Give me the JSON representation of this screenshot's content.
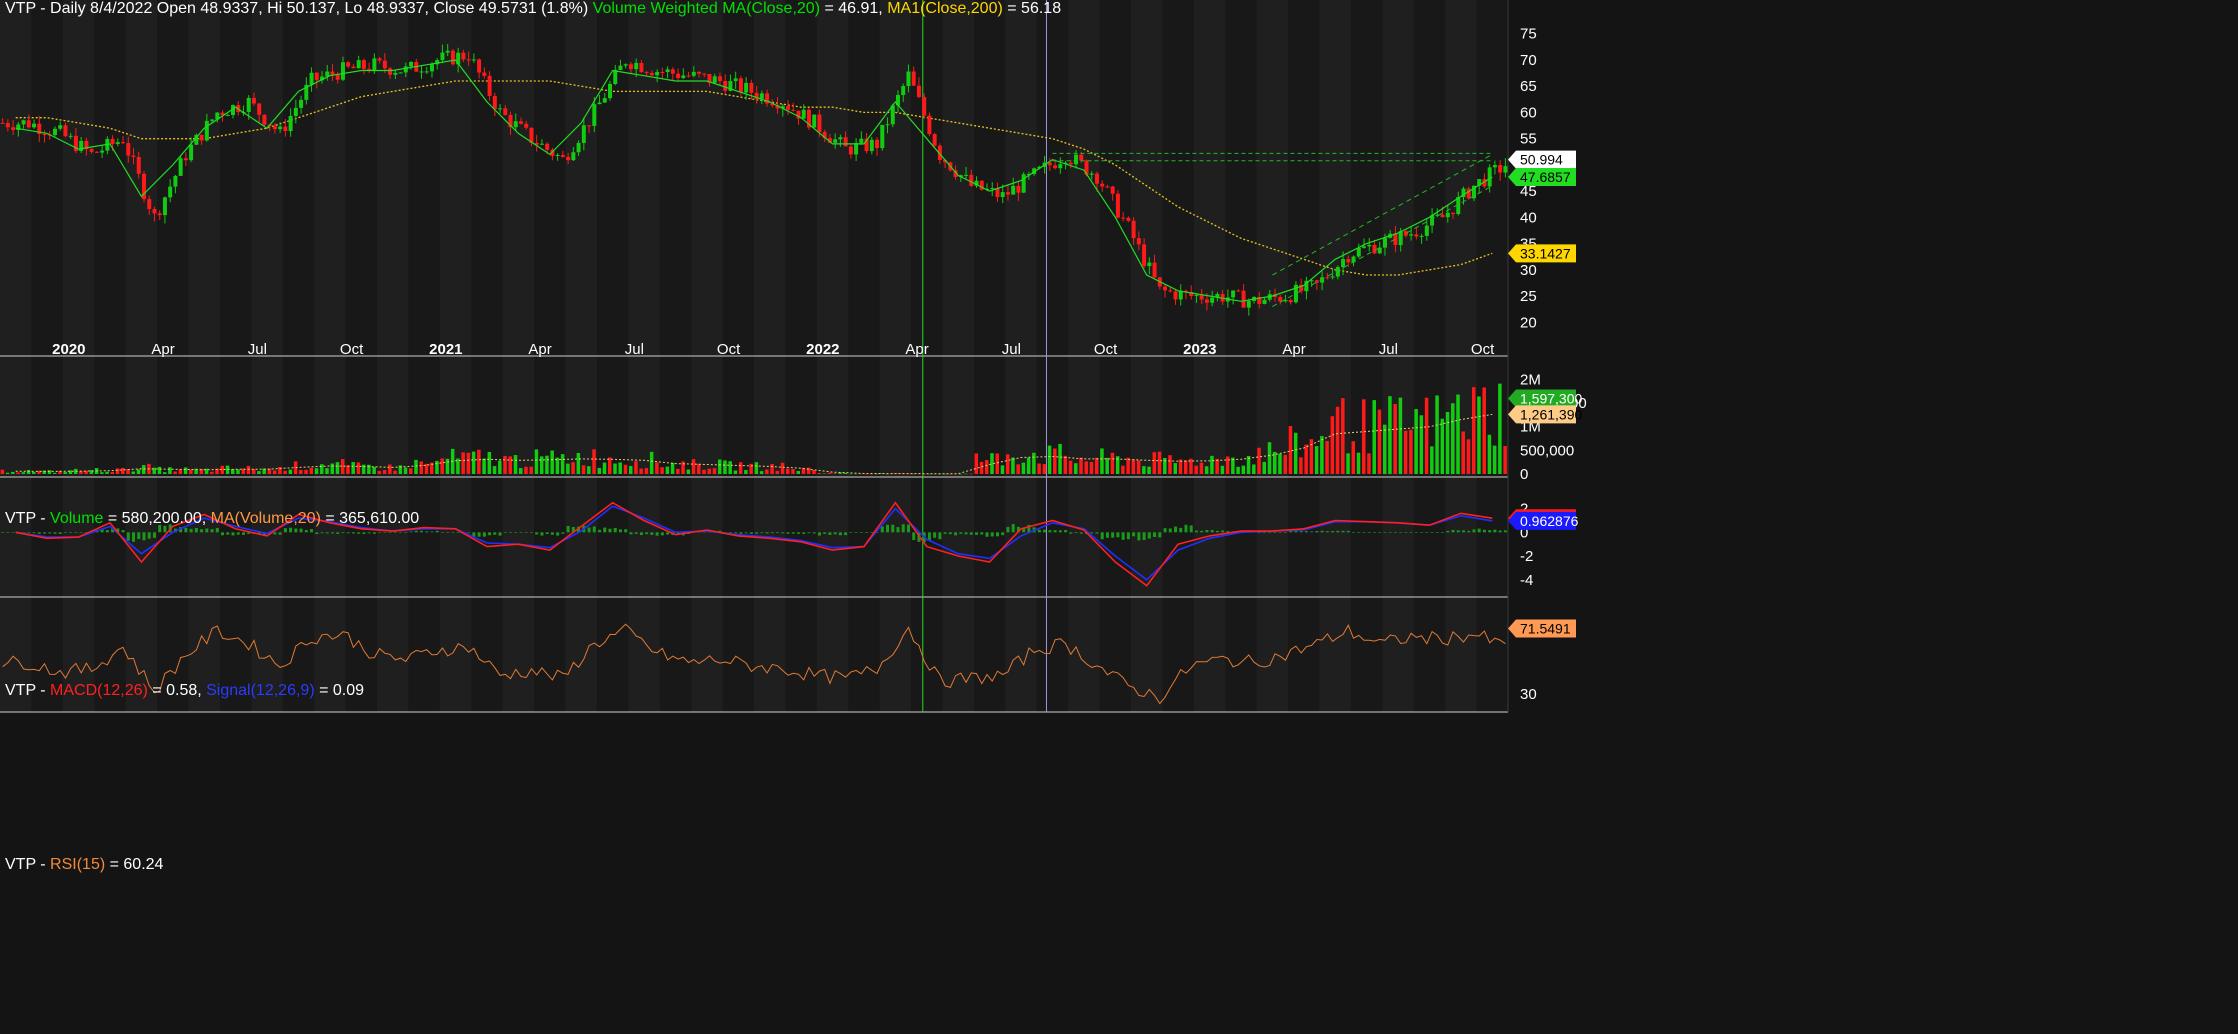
{
  "colors": {
    "background": "#141414",
    "band_a": "#1f1f1f",
    "band_b": "#181818",
    "up_candle": "#11cc11",
    "down_candle": "#ff1a1a",
    "vwma": "#22dd22",
    "ma200": "#e8c020",
    "volume_ma": "#ff9944",
    "macd": "#ff2020",
    "signal": "#2030ff",
    "histogram": "#1a9a1a",
    "rsi": "#e07a35",
    "axis_text": "#ffffff",
    "separator": "#cfcfcf"
  },
  "price_panel": {
    "symbol": "VTP",
    "sep": " - ",
    "title_text": "Daily 8/4/2022 Open 48.9337, Hi 50.137, Lo 48.9337, Close 49.5731 (1.8%)",
    "vwma_label": "Volume Weighted MA(Close,20)",
    "vwma_value": " = 46.91,",
    "ma_label": "MA1(Close,200)",
    "ma_value": " = 56.18",
    "y_ticks": [
      "75",
      "70",
      "65",
      "60",
      "55",
      "50",
      "45",
      "40",
      "35",
      "30",
      "25",
      "20"
    ],
    "x_labels": [
      "2020",
      "Apr",
      "Jul",
      "Oct",
      "2021",
      "Apr",
      "Jul",
      "Oct",
      "2022",
      "Apr",
      "Jul",
      "Oct",
      "2023",
      "Apr",
      "Jul",
      "Oct"
    ],
    "last_price_tag": "50.994",
    "vwma_tag": "47.6857",
    "ma200_tag": "33.1427"
  },
  "volume_panel": {
    "symbol": "VTP",
    "sep": " - ",
    "vol_label": "Volume",
    "vol_value": " = 580,200.00, ",
    "ma_label": "MA(Volume,20)",
    "ma_value": " = 365,610.00",
    "y_ticks": [
      "2M",
      "1,500,000",
      "1M",
      "500,000",
      "0"
    ],
    "vol_tag": "1,597,300",
    "ma_tag": "1,261,390"
  },
  "macd_panel": {
    "symbol": "VTP",
    "sep": " - ",
    "macd_label": "MACD(12,26)",
    "macd_value": " = 0.58, ",
    "signal_label": "Signal(12,26,9)",
    "signal_value": " = 0.09",
    "y_ticks": [
      "2",
      "0",
      "-2",
      "-4"
    ],
    "macd_tag": "1.18848",
    "signal_tag": "0.962876"
  },
  "rsi_panel": {
    "symbol": "VTP",
    "sep": " - ",
    "rsi_label": "RSI(15)",
    "rsi_value": " = 60.24",
    "y_ticks": [
      "70",
      "30"
    ],
    "rsi_tag": "71.5491"
  },
  "chart_data": [
    {
      "type": "candlestick",
      "title": "VTP - Daily 8/4/2022 Open 48.9337, Hi 50.137, Lo 48.9337, Close 49.5731 (1.8%)",
      "x": [
        "2019-11",
        "2019-12",
        "2020-01",
        "2020-02",
        "2020-03",
        "2020-04",
        "2020-05",
        "2020-06",
        "2020-07",
        "2020-08",
        "2020-09",
        "2020-10",
        "2020-11",
        "2020-12",
        "2021-01",
        "2021-02",
        "2021-03",
        "2021-04",
        "2021-05",
        "2021-06",
        "2021-07",
        "2021-08",
        "2021-09",
        "2021-10",
        "2021-11",
        "2021-12",
        "2022-01",
        "2022-02",
        "2022-03",
        "2022-04",
        "2022-05",
        "2022-06",
        "2022-07",
        "2022-08",
        "2022-09",
        "2022-10",
        "2022-11",
        "2022-12",
        "2023-01",
        "2023-02",
        "2023-03",
        "2023-04",
        "2023-05",
        "2023-06",
        "2023-07",
        "2023-08",
        "2023-09",
        "2023-10"
      ],
      "series": [
        {
          "name": "Close",
          "values": [
            58,
            56,
            52,
            55,
            40,
            52,
            60,
            62,
            56,
            66,
            68,
            69,
            68,
            70,
            71,
            60,
            55,
            51,
            60,
            70,
            68,
            67,
            66,
            64,
            62,
            58,
            53,
            54,
            67,
            52,
            46,
            44,
            48,
            52,
            48,
            38,
            26,
            25,
            25,
            24,
            25,
            27,
            33,
            35,
            37,
            40,
            46,
            50
          ]
        },
        {
          "name": "Volume Weighted MA(Close,20)",
          "values": [
            57,
            56,
            53,
            54,
            44,
            50,
            57,
            61,
            57,
            64,
            67,
            68,
            68,
            69,
            70,
            62,
            56,
            52,
            58,
            68,
            67,
            66,
            66,
            64,
            62,
            59,
            54,
            54,
            62,
            55,
            48,
            45,
            47,
            51,
            49,
            40,
            29,
            26,
            25,
            24,
            25,
            27,
            32,
            35,
            37,
            40,
            44,
            47.69
          ]
        },
        {
          "name": "MA1(Close,200)",
          "values": [
            59,
            59,
            58,
            57,
            55,
            55,
            55,
            56,
            57,
            59,
            61,
            63,
            64,
            65,
            66,
            66,
            66,
            66,
            65,
            64,
            64,
            64,
            64,
            63,
            62,
            61,
            61,
            60,
            60,
            59,
            58,
            57,
            56,
            55,
            53,
            50,
            46,
            42,
            39,
            36,
            34,
            32,
            30,
            29,
            29,
            30,
            31,
            33.14
          ]
        }
      ],
      "ylim": [
        17,
        78
      ],
      "y_ticks": [
        20,
        25,
        30,
        35,
        40,
        45,
        50,
        55,
        60,
        65,
        70,
        75
      ]
    },
    {
      "type": "bar",
      "title": "VTP - Volume = 580,200.00, MA(Volume,20) = 365,610.00",
      "series": [
        {
          "name": "Volume",
          "values": [
            60000,
            50000,
            70000,
            80000,
            130000,
            90000,
            80000,
            110000,
            100000,
            160000,
            190000,
            150000,
            130000,
            210000,
            320000,
            330000,
            280000,
            310000,
            340000,
            300000,
            280000,
            200000,
            190000,
            170000,
            150000,
            100000,
            20000,
            5000,
            8000,
            5000,
            5000,
            300000,
            400000,
            380000,
            300000,
            320000,
            280000,
            260000,
            290000,
            320000,
            450000,
            600000,
            1000000,
            950000,
            1000000,
            1050000,
            1200000,
            1300000
          ]
        },
        {
          "name": "MA(Volume,20)",
          "values": [
            60000,
            55000,
            60000,
            70000,
            110000,
            100000,
            90000,
            100000,
            100000,
            140000,
            170000,
            160000,
            140000,
            180000,
            280000,
            310000,
            290000,
            300000,
            320000,
            310000,
            290000,
            220000,
            200000,
            180000,
            160000,
            120000,
            40000,
            10000,
            8000,
            6000,
            6000,
            200000,
            350000,
            370000,
            320000,
            320000,
            290000,
            270000,
            280000,
            310000,
            400000,
            550000,
            850000,
            900000,
            950000,
            1000000,
            1150000,
            1261390
          ]
        }
      ],
      "ylim": [
        0,
        2200000
      ]
    },
    {
      "type": "line",
      "title": "VTP - MACD(12,26) = 0.58, Signal(12,26,9) = 0.09",
      "series": [
        {
          "name": "MACD(12,26)",
          "values": [
            0,
            -0.5,
            -0.4,
            0.8,
            -2.5,
            0.5,
            1.5,
            0.3,
            -0.3,
            1.5,
            0.8,
            0.3,
            0.1,
            0.4,
            0.3,
            -1.2,
            -1,
            -1.5,
            0.5,
            2.5,
            1,
            -0.2,
            0.2,
            -0.3,
            -0.5,
            -0.8,
            -1.5,
            -1.2,
            2.5,
            -1.2,
            -2,
            -2.5,
            0.3,
            1,
            0.2,
            -2.5,
            -4.5,
            -1,
            -0.3,
            0.1,
            0.1,
            0.3,
            1,
            0.9,
            0.8,
            0.6,
            1.6,
            1.19
          ]
        },
        {
          "name": "Signal(12,26,9)",
          "values": [
            0,
            -0.4,
            -0.4,
            0.5,
            -1.8,
            0,
            1.2,
            0.5,
            -0.1,
            1.2,
            0.9,
            0.4,
            0.1,
            0.3,
            0.3,
            -0.9,
            -1,
            -1.3,
            0.1,
            2.2,
            1.2,
            0,
            0.1,
            -0.2,
            -0.4,
            -0.7,
            -1.3,
            -1.2,
            2,
            -0.6,
            -1.8,
            -2.2,
            -0.3,
            0.8,
            0.3,
            -2,
            -4,
            -1.5,
            -0.5,
            0,
            0.1,
            0.2,
            0.9,
            0.9,
            0.8,
            0.6,
            1.4,
            0.96
          ]
        }
      ],
      "y_ticks": [
        -4,
        -2,
        0,
        2
      ],
      "ylim": [
        -5.2,
        3.4
      ]
    },
    {
      "type": "line",
      "title": "VTP - RSI(15) = 60.24",
      "series": [
        {
          "name": "RSI(15)",
          "values": [
            50,
            44,
            46,
            60,
            32,
            55,
            70,
            62,
            48,
            66,
            68,
            55,
            52,
            58,
            60,
            42,
            45,
            40,
            62,
            70,
            56,
            50,
            52,
            48,
            46,
            42,
            40,
            46,
            72,
            38,
            40,
            42,
            58,
            62,
            48,
            35,
            28,
            48,
            52,
            50,
            55,
            62,
            70,
            62,
            66,
            65,
            68,
            60.24
          ]
        }
      ],
      "y_ticks": [
        30,
        70
      ],
      "ylim": [
        20,
        82
      ]
    }
  ]
}
